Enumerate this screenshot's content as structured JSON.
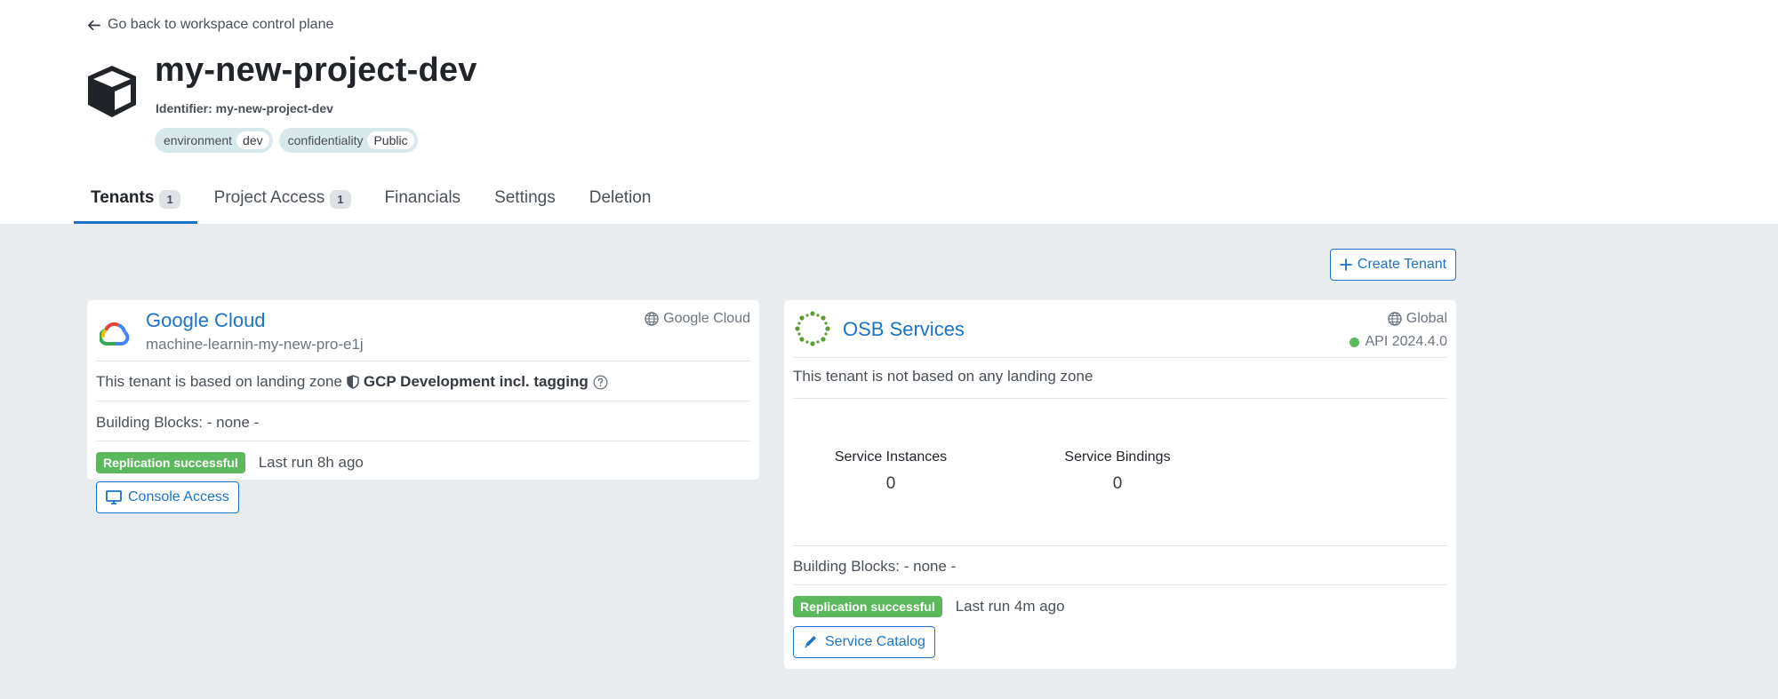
{
  "header": {
    "back_link": "Go back to workspace control plane",
    "project_title": "my-new-project-dev",
    "identifier": "Identifier: my-new-project-dev",
    "tags": [
      {
        "key": "environment",
        "value": "dev"
      },
      {
        "key": "confidentiality",
        "value": "Public"
      }
    ]
  },
  "tabs": [
    {
      "label": "Tenants",
      "count": "1",
      "active": true
    },
    {
      "label": "Project Access",
      "count": "1"
    },
    {
      "label": "Financials"
    },
    {
      "label": "Settings"
    },
    {
      "label": "Deletion"
    }
  ],
  "main": {
    "create_tenant_label": "Create Tenant",
    "tenants": [
      {
        "title": "Google Cloud",
        "subtitle": "machine-learnin-my-new-pro-e1j",
        "platform": "Google Cloud",
        "landing_zone_prefix": "This tenant is based on landing zone",
        "landing_zone_name": "GCP Development incl. tagging",
        "building_blocks": "Building Blocks: - none -",
        "status": "Replication successful",
        "last_run": "Last run 8h ago",
        "action_label": "Console Access"
      },
      {
        "title": "OSB Services",
        "platform": "Global",
        "api_version": "API 2024.4.0",
        "landing_zone_text": "This tenant is not based on any landing zone",
        "stats": [
          {
            "label": "Service Instances",
            "value": "0"
          },
          {
            "label": "Service Bindings",
            "value": "0"
          }
        ],
        "building_blocks": "Building Blocks: - none -",
        "status": "Replication successful",
        "last_run": "Last run 4m ago",
        "action_label": "Service Catalog"
      }
    ]
  },
  "colors": {
    "accent": "#1a73c8",
    "success": "#5cb85c",
    "page_bg": "#e8ecef"
  }
}
